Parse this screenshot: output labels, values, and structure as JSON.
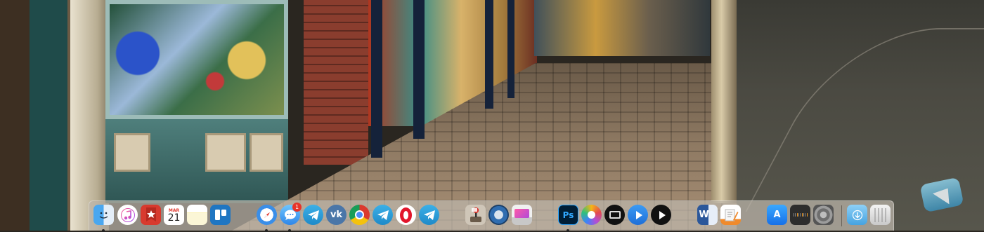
{
  "desktop": {
    "wallpaper": "night-street-photo"
  },
  "dock": {
    "apps": [
      {
        "id": "finder",
        "icon": "finder-icon",
        "running": true
      },
      {
        "id": "music",
        "icon": "music-note-icon",
        "running": false
      },
      {
        "id": "wunderlist",
        "icon": "star-ribbon-icon",
        "running": false
      },
      {
        "id": "calendar",
        "icon": "calendar-icon",
        "month": "MAR",
        "day": "21",
        "running": false
      },
      {
        "id": "notes",
        "icon": "notes-icon",
        "running": false
      },
      {
        "id": "trello",
        "icon": "trello-icon",
        "running": false
      },
      {
        "id": "safari",
        "icon": "compass-icon",
        "running": true
      },
      {
        "id": "messages",
        "icon": "speech-bubble-icon",
        "badge": "1",
        "running": true
      },
      {
        "id": "telegram",
        "icon": "paper-plane-icon",
        "running": false
      },
      {
        "id": "vk",
        "icon": "vk-logo-icon",
        "glyph": "vk",
        "running": false
      },
      {
        "id": "chrome",
        "icon": "chrome-icon",
        "running": false
      },
      {
        "id": "telegram-2",
        "icon": "paper-plane-icon",
        "running": false
      },
      {
        "id": "opera",
        "icon": "opera-icon",
        "running": false
      },
      {
        "id": "telegram-3",
        "icon": "paper-plane-icon",
        "running": false
      },
      {
        "id": "karabiner",
        "icon": "joystick-icon",
        "running": false
      },
      {
        "id": "disk-utility",
        "icon": "disk-icon",
        "running": false
      },
      {
        "id": "cleanmymac",
        "icon": "monitor-icon",
        "running": false
      },
      {
        "id": "photoshop",
        "icon": "photoshop-icon",
        "glyph": "Ps",
        "running": true
      },
      {
        "id": "photos",
        "icon": "photos-flower-icon",
        "running": false
      },
      {
        "id": "screenshot",
        "icon": "camera-icon",
        "running": false
      },
      {
        "id": "media-player",
        "icon": "play-icon",
        "running": false
      },
      {
        "id": "quicktime",
        "icon": "play-circle-icon",
        "running": false
      },
      {
        "id": "word",
        "icon": "word-icon",
        "glyph": "W",
        "running": false
      },
      {
        "id": "pages",
        "icon": "document-pen-icon",
        "running": false
      },
      {
        "id": "app-store",
        "icon": "app-store-icon",
        "glyph": "A",
        "running": false
      },
      {
        "id": "calculator",
        "icon": "calculator-icon",
        "running": false
      },
      {
        "id": "system-preferences",
        "icon": "gear-icon",
        "running": false
      },
      {
        "id": "downloads",
        "icon": "downloads-folder-icon",
        "running": false
      },
      {
        "id": "trash",
        "icon": "trash-icon",
        "running": false
      }
    ]
  },
  "colors": {
    "dock_background": "#bcb6aa",
    "badge": "#e8332a",
    "running_indicator": "#222222"
  }
}
